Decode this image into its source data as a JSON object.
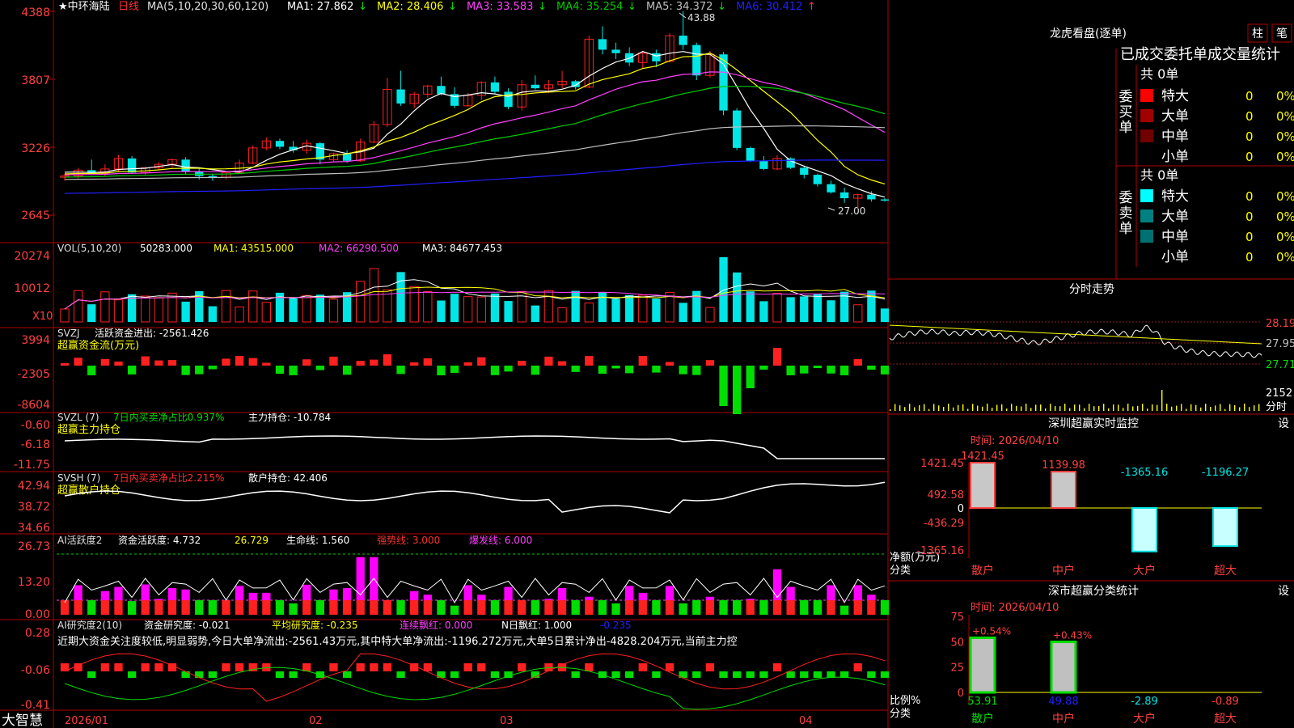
{
  "colors": {
    "up": "#ff2020",
    "down": "#00e5e5",
    "grid": "#b00000",
    "ma1": "#ffffff",
    "ma2": "#ffff00",
    "ma3": "#ff40ff",
    "ma4": "#00cc00",
    "ma5": "#c0c0c0",
    "ma6": "#2020ff",
    "green": "#00dd00",
    "magenta": "#ff00ff"
  },
  "header": {
    "stock_prefix": "★中环海陆",
    "period": "日线",
    "ma_label": "MA(5,10,20,30,60,120)",
    "ma_items": [
      {
        "label": "MA1: 27.862",
        "arrow": "↓",
        "color": "#ffffff"
      },
      {
        "label": "MA2: 28.406",
        "arrow": "↓",
        "color": "#ffff00"
      },
      {
        "label": "MA3: 33.583",
        "arrow": "↓",
        "color": "#ff40ff"
      },
      {
        "label": "MA4: 35.254",
        "arrow": "↓",
        "color": "#00cc00"
      },
      {
        "label": "MA5: 34.372",
        "arrow": "↓",
        "color": "#c0c0c0"
      },
      {
        "label": "MA6: 30.412",
        "arrow": "↑",
        "color": "#2020ff"
      }
    ],
    "high_mark": "43.88",
    "low_mark": "27.00"
  },
  "price_axis": [
    "4388",
    "3807",
    "3226",
    "2645"
  ],
  "vol": {
    "title": "VOL(5,10,20)",
    "value": "50283.000",
    "ma1": "MA1: 43515.000",
    "ma2": "MA2: 66290.500",
    "ma3": "MA3: 84677.453",
    "axis": [
      "20274",
      "10012"
    ],
    "unit": "X10"
  },
  "svzj": {
    "line1_a": "SVZJ",
    "line1_b": "活跃资金进出: -2561.426",
    "line2": "超赢资金流(万元)",
    "axis": [
      "3994",
      "-2305",
      "-8604"
    ]
  },
  "svzl": {
    "a": "SVZL (7)",
    "b": "7日内买卖净占比0.937%",
    "c": "主力持仓: -10.784",
    "line2": "超赢主力持仓",
    "axis": [
      "-0.60",
      "-6.18",
      "-11.75"
    ]
  },
  "svsh": {
    "a": "SVSH (7)",
    "b": "7日内买卖净占比2.215%",
    "c": "散户持仓: 42.406",
    "line2": "超赢散户持仓",
    "axis": [
      "42.94",
      "38.72",
      "34.66"
    ]
  },
  "ai1": {
    "a": "AI活跃度2",
    "b": "资金活跃度: 4.732",
    "c": "26.729",
    "d": "生命线: 1.560",
    "e": "强势线: 3.000",
    "f": "爆发线: 6.000",
    "axis": [
      "26.73",
      "13.20",
      "0.00"
    ]
  },
  "ai2": {
    "a": "AI研究度2(10)",
    "b": "资金研究度: -0.021",
    "c": "平均研究度: -0.235",
    "d": "连续飘红: 0.000",
    "e": "N日飘红: 1.000",
    "f": "-0.235",
    "note": "近期大资金关注度较低,明显弱势,今日大单净流出:-2561.43万元,其中特大单净流出:-1196.272万元,大单5日累计净出-4828.204万元,当前主力控",
    "axis": [
      "0.28",
      "-0.06",
      "-0.41"
    ]
  },
  "date_axis": [
    "2026/01",
    "02",
    "03",
    "04"
  ],
  "brand": "大智慧",
  "lhb": {
    "title": "龙虎看盘(逐单)",
    "tab1": "柱",
    "tab2": "笔",
    "subtitle": "已成交委托单成交量统计",
    "buy_side": "委买单",
    "sell_side": "委卖单",
    "buy_total": "共 0单",
    "sell_total": "共 0单",
    "buy_rows": [
      {
        "label": "特大",
        "n": "0",
        "pct": "0%",
        "color": "#ff0000"
      },
      {
        "label": "大单",
        "n": "0",
        "pct": "0%",
        "color": "#a00000"
      },
      {
        "label": "中单",
        "n": "0",
        "pct": "0%",
        "color": "#700000"
      },
      {
        "label": "小单",
        "n": "0",
        "pct": "0%",
        "color": "#000000"
      }
    ],
    "sell_rows": [
      {
        "label": "特大",
        "n": "0",
        "pct": "0%",
        "color": "#00ffff"
      },
      {
        "label": "大单",
        "n": "0",
        "pct": "0%",
        "color": "#008080"
      },
      {
        "label": "中单",
        "n": "0",
        "pct": "0%",
        "color": "#007070"
      },
      {
        "label": "小单",
        "n": "0",
        "pct": "0%",
        "color": "#000000"
      }
    ]
  },
  "intraday": {
    "title": "分时走势",
    "axis": [
      "28.19",
      "27.95",
      "27.71"
    ],
    "vol_axis": "2152",
    "vol_unit": "分时"
  },
  "monitor": {
    "title": "深圳超赢实时监控",
    "set": "设",
    "date": "时间: 2026/04/10",
    "axis": [
      "1421.45",
      "492.58",
      "0",
      "-436.29",
      "-1365.16"
    ],
    "ylabel": "净额(万元)",
    "xlabel": "分类",
    "bars": [
      {
        "cat": "散户",
        "value": "1421.45"
      },
      {
        "cat": "中户",
        "value": "1139.98"
      },
      {
        "cat": "大户",
        "value": "-1365.16"
      },
      {
        "cat": "超大",
        "value": "-1196.27"
      }
    ]
  },
  "classify": {
    "title": "深市超赢分类统计",
    "set": "设",
    "date": "时间: 2026/04/10",
    "axis": [
      "75",
      "50",
      "25",
      "0"
    ],
    "ylabel": "比例%",
    "xlabel": "分类",
    "bars": [
      {
        "cat": "散户",
        "top": "+0.54%",
        "bottom": "53.91"
      },
      {
        "cat": "中户",
        "top": "+0.43%",
        "bottom": "49.88"
      },
      {
        "cat": "大户",
        "top": "",
        "bottom": "-2.89"
      },
      {
        "cat": "超大",
        "top": "",
        "bottom": "-0.89"
      }
    ]
  },
  "chart_data": {
    "type": "candlestick",
    "title": "中环海陆 日线",
    "ylim": [
      26.45,
      43.88
    ],
    "x": [
      "2026/01",
      "02",
      "03",
      "04"
    ],
    "series": [
      {
        "name": "OHLC",
        "values": [
          [
            29.7,
            30.0,
            29.4,
            29.8
          ],
          [
            29.8,
            30.5,
            29.6,
            30.3
          ],
          [
            30.3,
            31.2,
            30.1,
            30.0
          ],
          [
            30.0,
            30.8,
            29.8,
            30.4
          ],
          [
            30.4,
            31.6,
            30.2,
            31.3
          ],
          [
            31.3,
            31.5,
            30.0,
            30.1
          ],
          [
            30.1,
            30.6,
            29.9,
            30.5
          ],
          [
            30.5,
            31.0,
            30.3,
            30.8
          ],
          [
            30.8,
            31.3,
            30.5,
            31.2
          ],
          [
            31.2,
            31.4,
            29.9,
            30.2
          ],
          [
            30.2,
            30.5,
            29.5,
            29.8
          ],
          [
            29.8,
            30.0,
            29.4,
            29.7
          ],
          [
            29.7,
            30.2,
            29.5,
            30.1
          ],
          [
            30.1,
            31.2,
            30.0,
            30.9
          ],
          [
            30.9,
            32.4,
            30.8,
            32.2
          ],
          [
            32.2,
            33.1,
            32.0,
            32.8
          ],
          [
            32.8,
            33.0,
            32.1,
            32.3
          ],
          [
            32.3,
            32.8,
            31.8,
            32.0
          ],
          [
            32.0,
            32.9,
            31.7,
            32.6
          ],
          [
            32.6,
            32.7,
            30.8,
            31.2
          ],
          [
            31.2,
            31.8,
            31.0,
            31.7
          ],
          [
            31.7,
            32.0,
            30.9,
            31.1
          ],
          [
            31.1,
            33.0,
            31.0,
            32.7
          ],
          [
            32.7,
            34.5,
            32.6,
            34.2
          ],
          [
            34.2,
            38.2,
            34.0,
            37.2
          ],
          [
            37.2,
            38.8,
            35.8,
            36.0
          ],
          [
            36.0,
            37.0,
            35.6,
            36.8
          ],
          [
            36.8,
            37.6,
            36.5,
            37.5
          ],
          [
            37.5,
            38.3,
            36.7,
            36.8
          ],
          [
            36.8,
            37.4,
            35.6,
            35.8
          ],
          [
            35.8,
            36.9,
            35.7,
            36.7
          ],
          [
            36.7,
            37.9,
            36.3,
            37.8
          ],
          [
            37.8,
            38.3,
            36.8,
            37.0
          ],
          [
            37.0,
            37.3,
            35.5,
            35.7
          ],
          [
            35.7,
            38.0,
            35.4,
            37.6
          ],
          [
            37.6,
            38.4,
            37.2,
            37.3
          ],
          [
            37.3,
            38.0,
            36.9,
            37.6
          ],
          [
            37.6,
            38.8,
            37.3,
            37.9
          ],
          [
            37.9,
            38.0,
            37.2,
            37.4
          ],
          [
            37.4,
            41.8,
            37.3,
            41.5
          ],
          [
            41.5,
            42.6,
            40.2,
            40.6
          ],
          [
            40.6,
            41.2,
            39.8,
            40.3
          ],
          [
            40.3,
            40.8,
            39.2,
            39.5
          ],
          [
            39.5,
            40.5,
            39.0,
            40.3
          ],
          [
            40.3,
            40.6,
            39.1,
            39.6
          ],
          [
            39.6,
            42.0,
            39.5,
            41.8
          ],
          [
            41.8,
            43.88,
            40.6,
            41.0
          ],
          [
            41.0,
            41.2,
            38.0,
            38.4
          ],
          [
            38.4,
            40.5,
            38.2,
            40.2
          ],
          [
            40.2,
            40.4,
            35.0,
            35.4
          ],
          [
            35.4,
            35.6,
            32.0,
            32.2
          ],
          [
            32.2,
            32.3,
            31.0,
            31.1
          ],
          [
            31.1,
            31.5,
            30.3,
            30.4
          ],
          [
            30.4,
            31.6,
            30.3,
            31.3
          ],
          [
            31.3,
            31.4,
            30.4,
            30.5
          ],
          [
            30.5,
            30.7,
            29.6,
            29.9
          ],
          [
            29.9,
            30.0,
            28.9,
            29.1
          ],
          [
            29.1,
            29.4,
            28.3,
            28.4
          ],
          [
            28.4,
            28.8,
            27.5,
            27.9
          ],
          [
            27.9,
            28.3,
            27.0,
            28.2
          ],
          [
            28.2,
            28.5,
            27.6,
            27.8
          ],
          [
            27.8,
            27.9,
            27.6,
            27.7
          ]
        ]
      }
    ]
  }
}
